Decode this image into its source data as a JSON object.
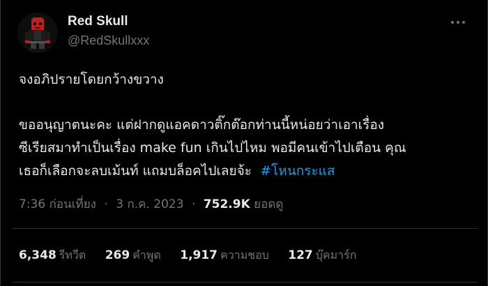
{
  "user": {
    "name": "Red Skull",
    "handle": "@RedSkullxxx"
  },
  "tweet": {
    "line1": "จงอภิปรายโดยกว้างขวาง",
    "line2": "ขออนุญาตนะคะ แต่ฝากดูแอคดาวติ๊กต๊อกท่านนี้หน่อยว่าเอาเรื่อง",
    "line3": "ซีเรียสมาทำเป็นเรื่อง make fun เกินไปไหม พอมีคนเข้าไปเตือน คุณ",
    "line4": "เธอก็เลือกจะลบเม้นท์ แถมบล็อคไปเลยจ้ะ",
    "hashtag": "#โหนกระแส"
  },
  "meta": {
    "time": "7:36 ก่อนเที่ยง",
    "separator": "·",
    "date": "3 ก.ค. 2023",
    "views_count": "752.9K",
    "views_label": "ยอดดู"
  },
  "stats": {
    "retweets": {
      "count": "6,348",
      "label": "รีทวีต"
    },
    "quotes": {
      "count": "269",
      "label": "คำพูด"
    },
    "likes": {
      "count": "1,917",
      "label": "ความชอบ"
    },
    "bookmarks": {
      "count": "127",
      "label": "บุ๊คมาร์ก"
    }
  },
  "icons": {
    "more": "more-dots-icon",
    "avatar": "red-skull-pixel-avatar"
  },
  "colors": {
    "background": "#000000",
    "text_primary": "#e7e9ea",
    "text_secondary": "#71767b",
    "accent": "#1d9bf0",
    "divider": "#2f3336"
  }
}
